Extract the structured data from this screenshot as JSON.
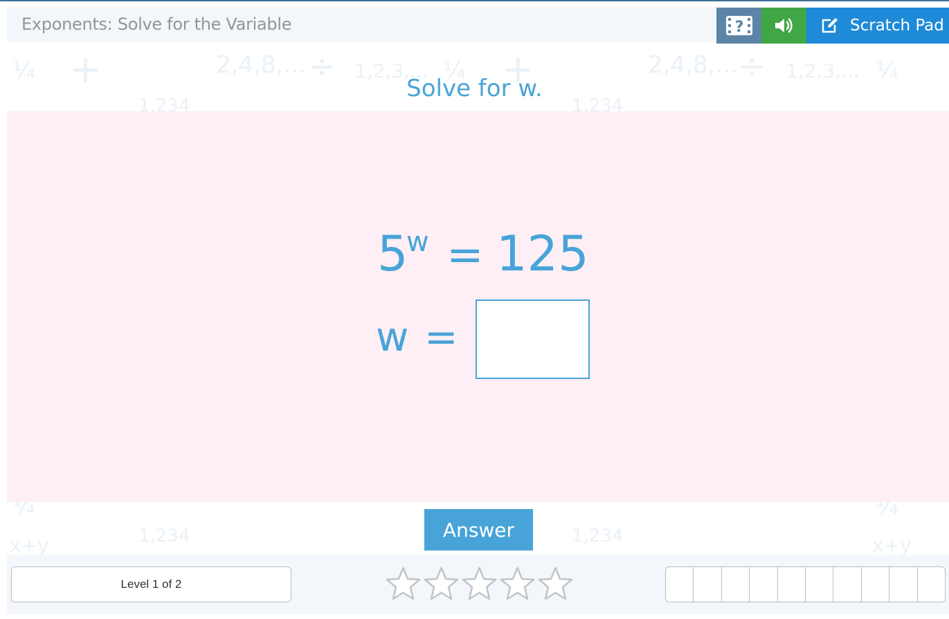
{
  "header": {
    "title": "Exponents: Solve for the Variable",
    "scratch_pad_label": "Scratch Pad"
  },
  "question": {
    "prompt": "Solve for w.",
    "equation": {
      "base": "5",
      "exponent": "w",
      "equals": "=",
      "rhs": "125"
    },
    "solve_line": {
      "variable": "w",
      "equals": "="
    },
    "answer_value": ""
  },
  "answer_button_label": "Answer",
  "footer": {
    "level_text": "Level 1 of 2",
    "stars_total": 5,
    "stars_earned": 0,
    "progress_cells": 10,
    "progress_completed": 0
  },
  "background_symbols": [
    "¼",
    "+",
    "2,4,8,...",
    "÷",
    "1,2,3,...",
    "1,234",
    "x+y",
    "?"
  ],
  "colors": {
    "accent": "#48a4d8",
    "video_button": "#5c84a6",
    "audio_button": "#41a646",
    "scratch_button": "#1e8ad8",
    "panel": "#fdeff5"
  },
  "icons": {
    "video": "video-help-icon",
    "audio": "speaker-icon",
    "scratch": "pencil-edit-icon",
    "star": "star-outline-icon"
  }
}
